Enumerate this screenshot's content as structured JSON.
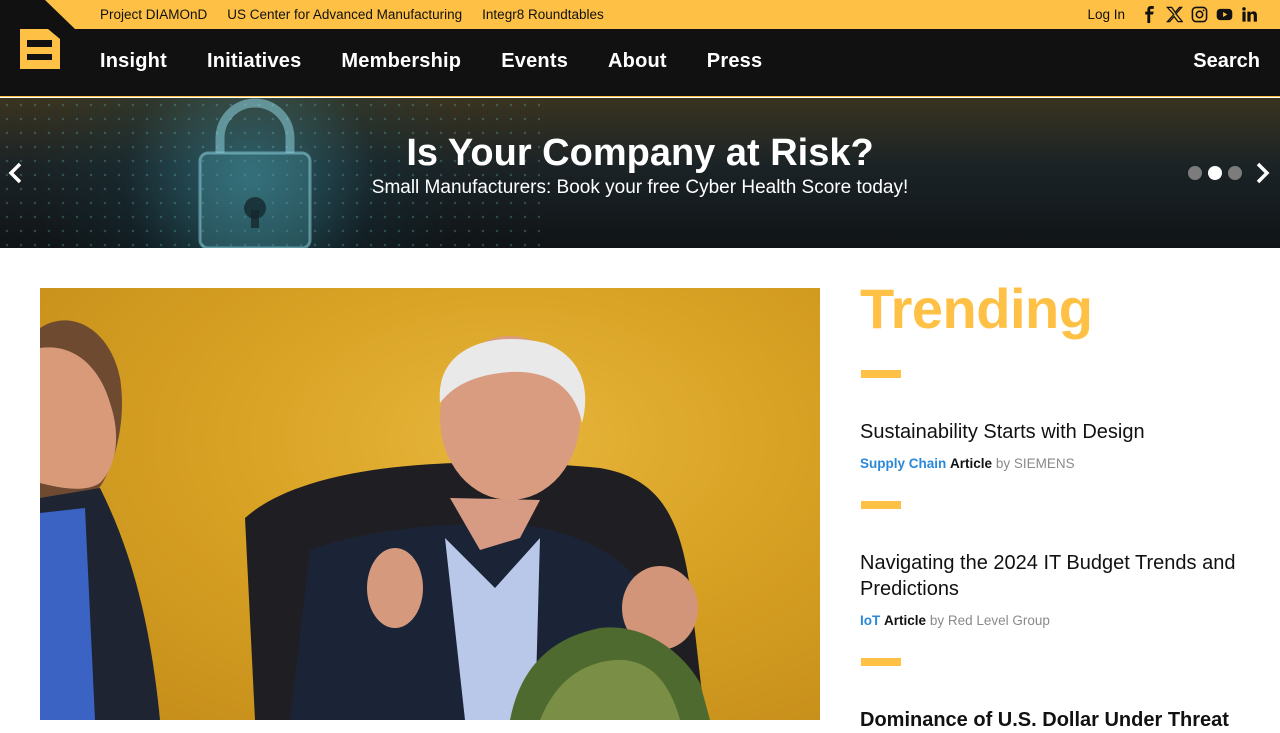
{
  "topbar": {
    "links": [
      "Project DIAMOnD",
      "US Center for Advanced Manufacturing",
      "Integr8 Roundtables"
    ],
    "login": "Log In",
    "social": [
      "facebook-icon",
      "x-icon",
      "instagram-icon",
      "youtube-icon",
      "linkedin-icon"
    ],
    "color": "#ffc145"
  },
  "nav": {
    "items": [
      "Insight",
      "Initiatives",
      "Membership",
      "Events",
      "About",
      "Press"
    ],
    "search": "Search",
    "background": "#111111"
  },
  "hero": {
    "title": "Is Your Company at Risk?",
    "subtitle": "Small Manufacturers: Book your free Cyber Health Score today!",
    "slides": 3,
    "active_slide": 2
  },
  "trending": {
    "heading": "Trending",
    "items": [
      {
        "title": "Sustainability Starts with Design",
        "category": "Supply Chain",
        "type": "Article",
        "by": "by SIEMENS"
      },
      {
        "title": "Navigating the 2024 IT Budget Trends and Predictions",
        "category": "IoT",
        "type": "Article",
        "by": "by Red Level Group"
      },
      {
        "title": "Dominance of U.S. Dollar Under Threat"
      }
    ]
  },
  "colors": {
    "accent": "#ffc145",
    "link": "#2a88d8"
  }
}
